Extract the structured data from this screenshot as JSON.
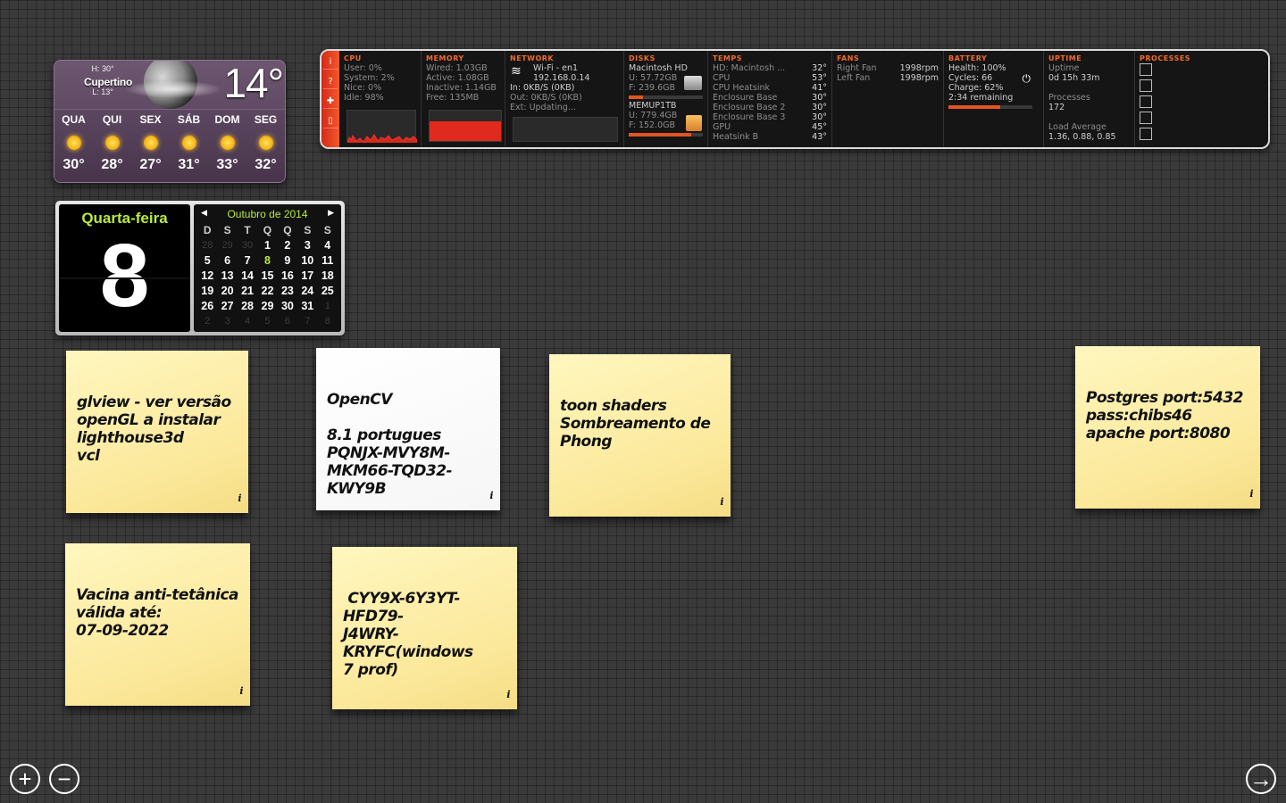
{
  "weather": {
    "hi": "H: 30°",
    "city": "Cupertino",
    "lo": "L: 13°",
    "temp": "14°",
    "days": [
      {
        "name": "QUA",
        "temp": "30°"
      },
      {
        "name": "QUI",
        "temp": "28°"
      },
      {
        "name": "SEX",
        "temp": "27°"
      },
      {
        "name": "SÁB",
        "temp": "31°"
      },
      {
        "name": "DOM",
        "temp": "33°"
      },
      {
        "name": "SEG",
        "temp": "32°"
      }
    ]
  },
  "stats": {
    "cpu": {
      "header": "CPU",
      "user": "User: 0%",
      "system": "System: 2%",
      "nice": "Nice: 0%",
      "idle": "Idle: 98%"
    },
    "memory": {
      "header": "MEMORY",
      "wired": "Wired: 1.03GB",
      "active": "Active: 1.08GB",
      "inactive": "Inactive: 1.14GB",
      "free": "Free: 135MB"
    },
    "network": {
      "header": "NETWORK",
      "iface": "Wi-Fi - en1",
      "ip": "192.168.0.14",
      "in": "In: 0KB/S (0KB)",
      "out": "Out: 0KB/S (0KB)",
      "ext": "Ext: Updating..."
    },
    "disks": {
      "header": "DISKS",
      "d1_name": "Macintosh HD",
      "d1_used": "U: 57.72GB",
      "d1_free": "F: 239.6GB",
      "d1_fill": 0.19,
      "d2_name": "MEMUP1TB",
      "d2_used": "U: 779.4GB",
      "d2_free": "F: 152.0GB",
      "d2_fill": 0.84
    },
    "temps": {
      "header": "TEMPS",
      "rows": [
        {
          "name": "HD: Macintosh ...",
          "value": "32°"
        },
        {
          "name": "CPU",
          "value": "53°"
        },
        {
          "name": "CPU Heatsink",
          "value": "41°"
        },
        {
          "name": "Enclosure Base",
          "value": "30°"
        },
        {
          "name": "Enclosure Base 2",
          "value": "30°"
        },
        {
          "name": "Enclosure Base 3",
          "value": "30°"
        },
        {
          "name": "GPU",
          "value": "45°"
        },
        {
          "name": "Heatsink B",
          "value": "43°"
        }
      ]
    },
    "fans": {
      "header": "FANS",
      "rows": [
        {
          "name": "Right Fan",
          "value": "1998rpm"
        },
        {
          "name": "Left Fan",
          "value": "1998rpm"
        }
      ]
    },
    "battery": {
      "header": "BATTERY",
      "health": "Health: 100%",
      "cycles": "Cycles: 66",
      "charge": "Charge: 62%",
      "remaining": "2:34 remaining",
      "charge_fill": 0.62
    },
    "uptime": {
      "header": "UPTIME",
      "label": "Uptime",
      "value": "0d 15h 33m",
      "processes_label": "Processes",
      "processes": "172",
      "load_label": "Load Average",
      "load": "1.36, 0.88, 0.85"
    },
    "processes": {
      "header": "PROCESSES"
    }
  },
  "calendar": {
    "weekday": "Quarta-feira",
    "day": "8",
    "month": "Outubro de 2014",
    "headers": [
      "D",
      "S",
      "T",
      "Q",
      "Q",
      "S",
      "S"
    ],
    "weeks": [
      [
        "28",
        "29",
        "30",
        "1",
        "2",
        "3",
        "4"
      ],
      [
        "5",
        "6",
        "7",
        "8",
        "9",
        "10",
        "11"
      ],
      [
        "12",
        "13",
        "14",
        "15",
        "16",
        "17",
        "18"
      ],
      [
        "19",
        "20",
        "21",
        "22",
        "23",
        "24",
        "25"
      ],
      [
        "26",
        "27",
        "28",
        "29",
        "30",
        "31",
        "1"
      ],
      [
        "2",
        "3",
        "4",
        "5",
        "6",
        "7",
        "8"
      ]
    ]
  },
  "stickies": {
    "s1": "glview - ver versão\nopenGL a instalar\nlighthouse3d\nvcl",
    "s2": "OpenCV\n\n8.1 portugues\nPQNJX-MVY8M-\nMKM66-TQD32-KWY9B",
    "s3": "toon shaders\nSombreamento de Phong",
    "s4": "Postgres port:5432\npass:chibs46\napache port:8080",
    "s5": "Vacina anti-tetânica\nválida até:\n07-09-2022",
    "s6": " CYY9X-6Y3YT-HFD79-\nJ4WRY-KRYFC(windows\n7 prof)",
    "info": "i"
  },
  "controls": {
    "add": "+",
    "remove": "−",
    "next": "→"
  }
}
